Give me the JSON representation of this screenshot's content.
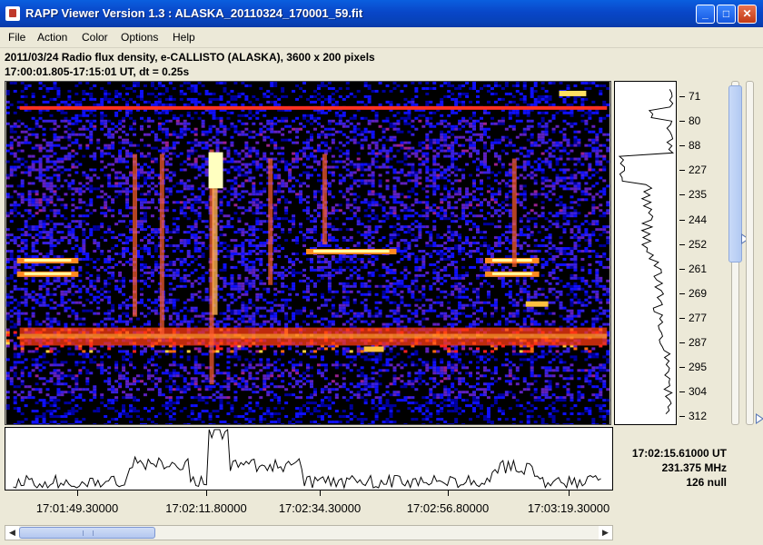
{
  "window": {
    "title": "RAPP Viewer Version 1.3 : ALASKA_20110324_170001_59.fit",
    "buttons": [
      "minimize-icon",
      "maximize-icon",
      "close-icon"
    ]
  },
  "menu": [
    "File",
    "Action",
    "Color",
    "Options",
    "Help"
  ],
  "info": {
    "line1": "2011/03/24  Radio flux density, e-CALLISTO (ALASKA),  3600 x 200 pixels",
    "line2": "17:00:01.805-17:15:01 UT,  dt = 0.25s"
  },
  "frequency_axis": {
    "ticks": [
      "71",
      "80",
      "88",
      "227",
      "235",
      "244",
      "252",
      "261",
      "269",
      "277",
      "287",
      "295",
      "304",
      "312"
    ]
  },
  "time_axis": {
    "ticks": [
      "17:01:49.30000",
      "17:02:11.80000",
      "17:02:34.30000",
      "17:02:56.80000",
      "17:03:19.30000"
    ]
  },
  "cursor": {
    "time": "17:02:15.61000 UT",
    "frequency": "231.375 MHz",
    "value": "126 null"
  },
  "colors": {
    "window_bg": "#ece9d8",
    "titlebar": "#0a4fd0",
    "spectrogram_low": "#000000",
    "spectrogram_mid": "#1a1aff",
    "spectrogram_high": "#ff2a00",
    "spectrogram_peak": "#ffff66"
  }
}
